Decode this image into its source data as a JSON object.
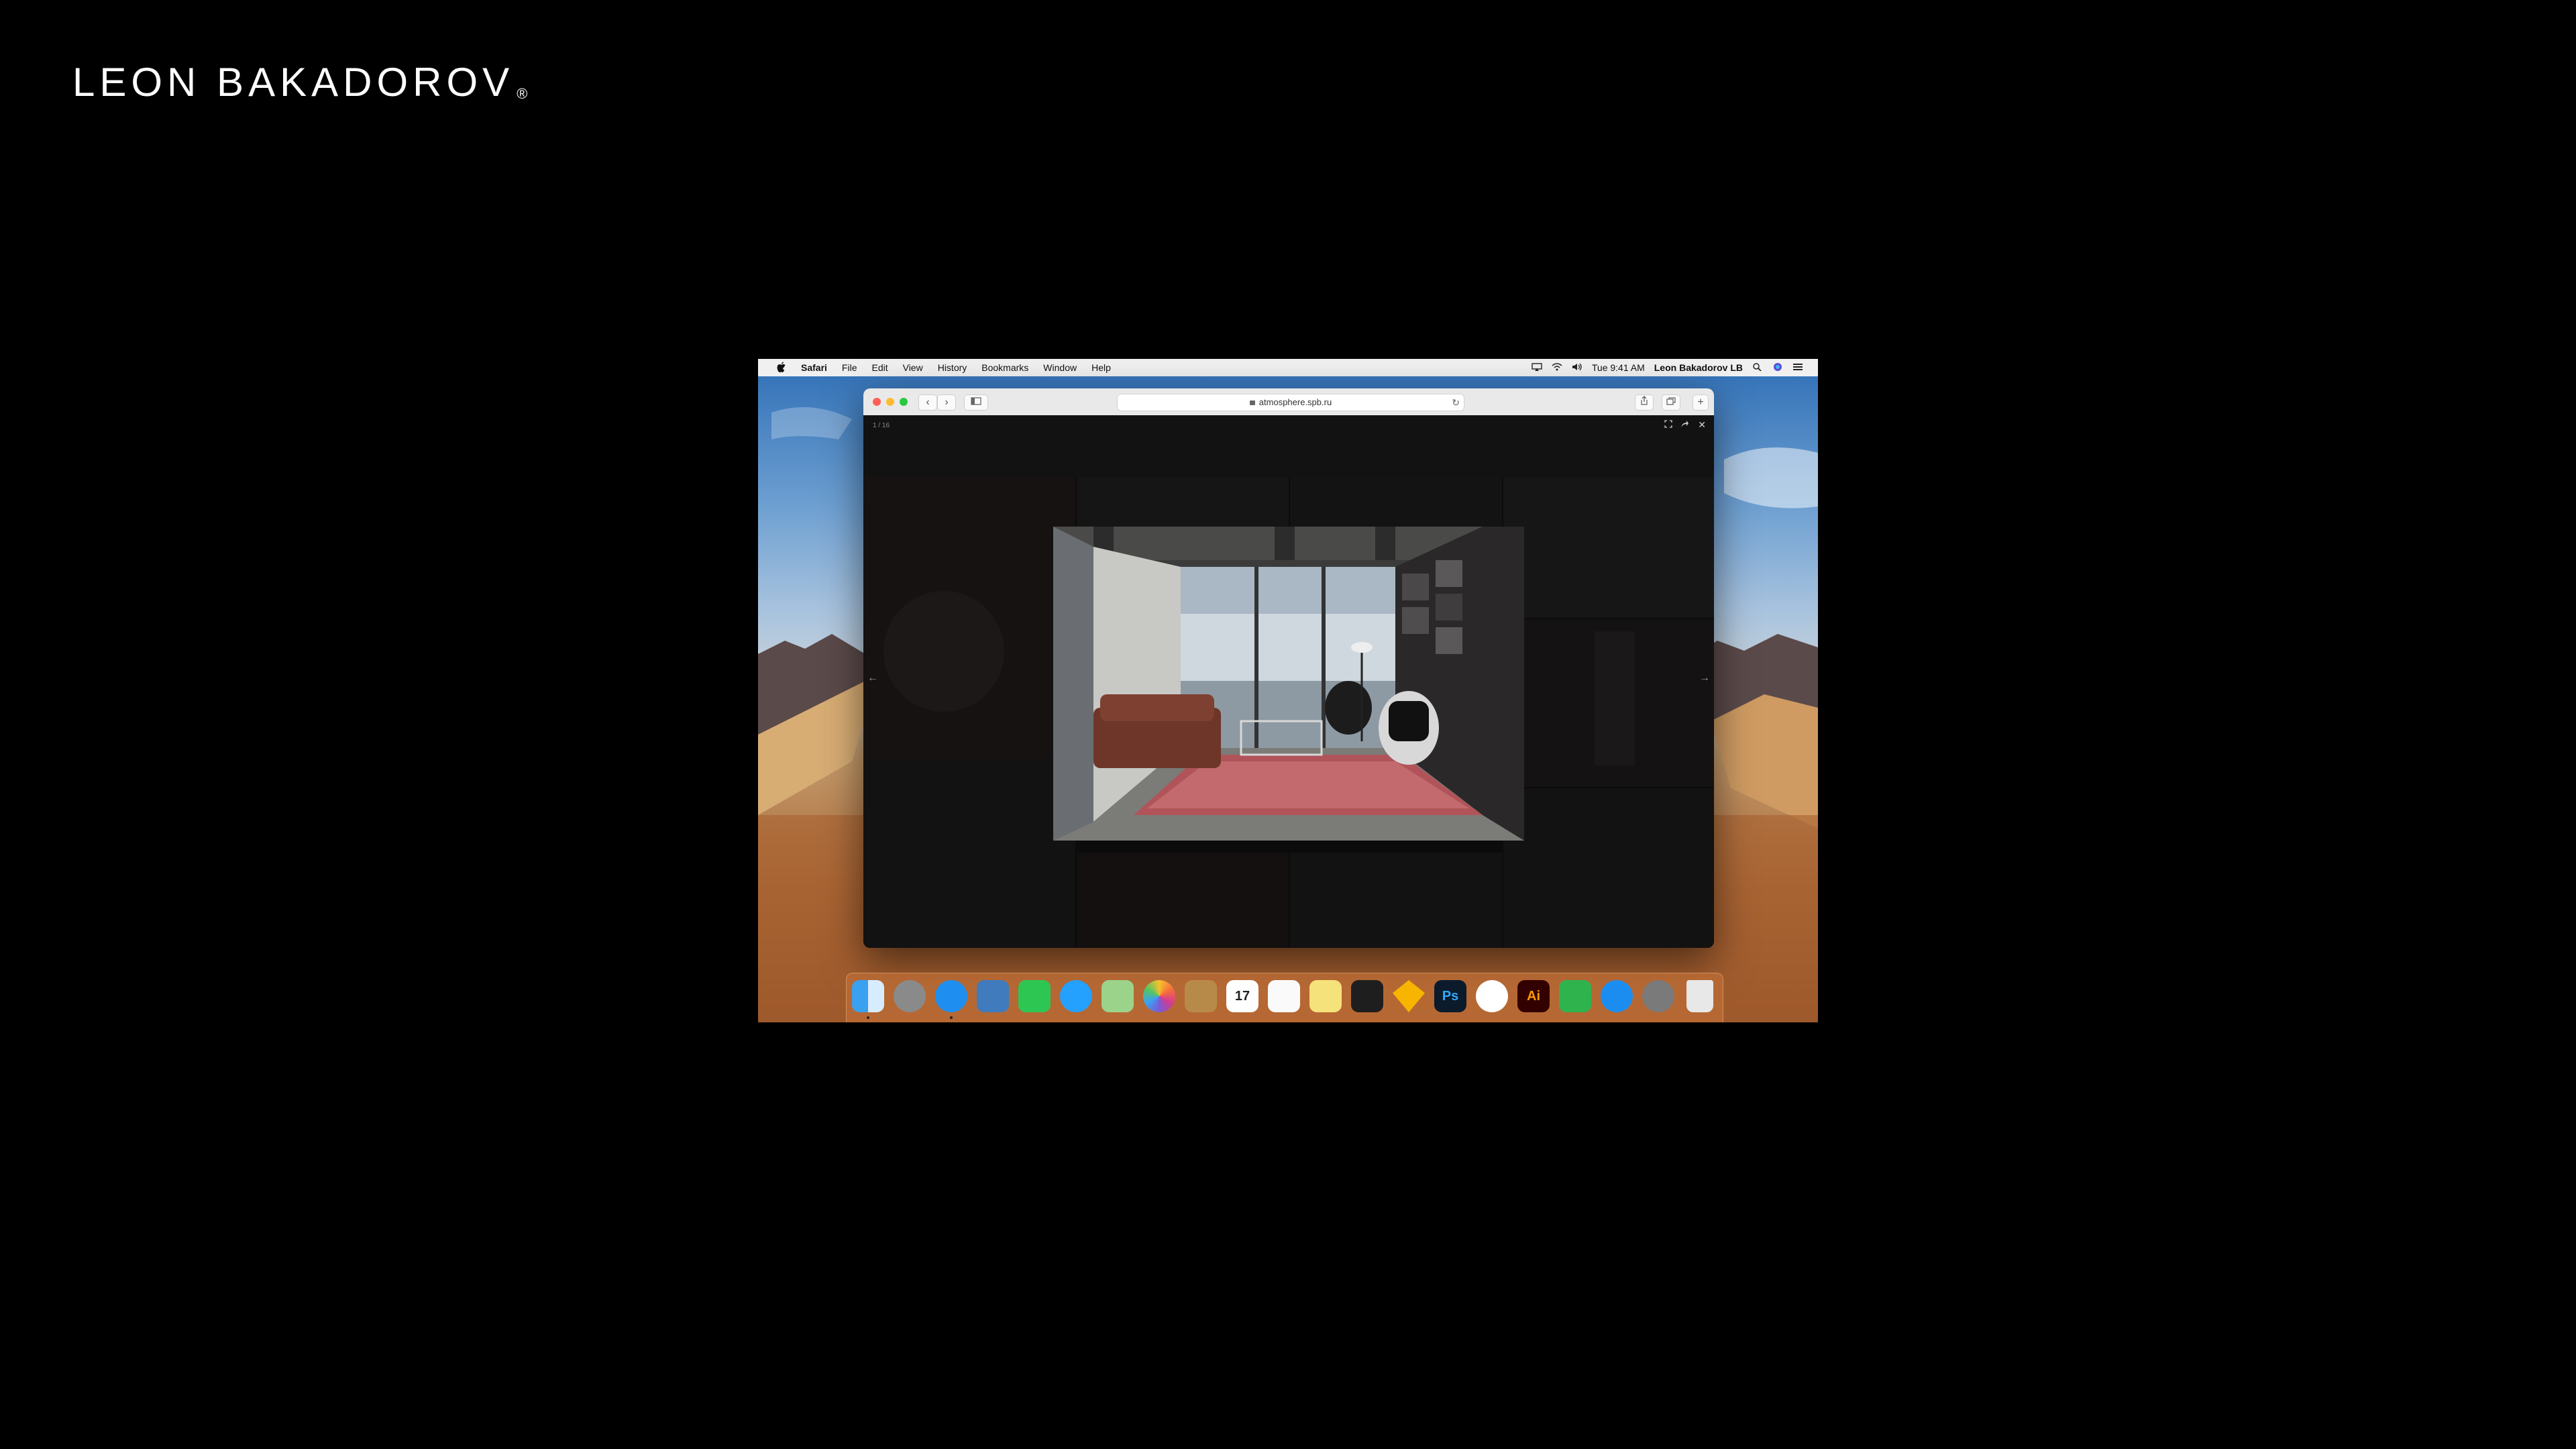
{
  "brand": {
    "name": "LEON BAKADOROV",
    "mark": "®"
  },
  "menubar": {
    "app": "Safari",
    "items": [
      "File",
      "Edit",
      "View",
      "History",
      "Bookmarks",
      "Window",
      "Help"
    ],
    "clock": "Tue 9:41 AM",
    "user": "Leon Bakadorov LB"
  },
  "browser": {
    "url": "atmosphere.spb.ru",
    "back_icon": "chevron-left-icon",
    "forward_icon": "chevron-right-icon"
  },
  "lightbox": {
    "counter": "1 / 16",
    "prev": "←",
    "next": "→",
    "close": "✕"
  },
  "dock": {
    "apps": [
      "Finder",
      "Launchpad",
      "Safari",
      "Preview",
      "FaceTime",
      "Messages",
      "Maps",
      "Photos",
      "Notes",
      "Calendar",
      "Reminders",
      "Stickies",
      "Figma",
      "Sketch",
      "Photoshop",
      "Music",
      "Illustrator",
      "Numbers",
      "App Store",
      "System Preferences",
      "Trash"
    ],
    "calendar_day": "17",
    "ps_label": "Ps",
    "ai_label": "Ai"
  },
  "colors": {
    "accent": "#2d7cf6",
    "desktop_sand": "#b3703e"
  }
}
